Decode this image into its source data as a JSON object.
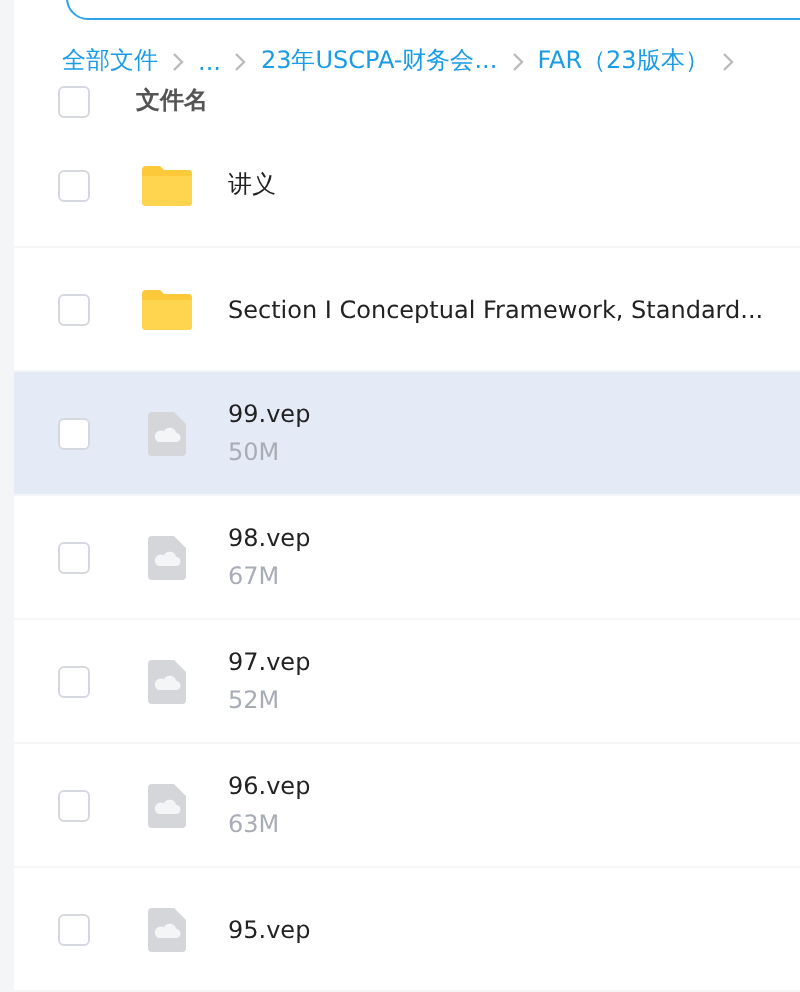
{
  "breadcrumb": [
    {
      "label": "全部文件"
    },
    {
      "label": "..."
    },
    {
      "label": "23年USCPA-财务会..."
    },
    {
      "label": "FAR（23版本）"
    }
  ],
  "header": {
    "name_column": "文件名",
    "checked": false
  },
  "files": [
    {
      "kind": "folder",
      "name": "讲义",
      "checked": false,
      "highlighted": false
    },
    {
      "kind": "folder",
      "name": "Section I Conceptual Framework, Standard...",
      "checked": false,
      "highlighted": false
    },
    {
      "kind": "file",
      "name": "99.vep",
      "size": "50M",
      "checked": false,
      "highlighted": true
    },
    {
      "kind": "file",
      "name": "98.vep",
      "size": "67M",
      "checked": false,
      "highlighted": false
    },
    {
      "kind": "file",
      "name": "97.vep",
      "size": "52M",
      "checked": false,
      "highlighted": false
    },
    {
      "kind": "file",
      "name": "96.vep",
      "size": "63M",
      "checked": false,
      "highlighted": false
    },
    {
      "kind": "file",
      "name": "95.vep",
      "checked": false,
      "highlighted": false
    }
  ]
}
